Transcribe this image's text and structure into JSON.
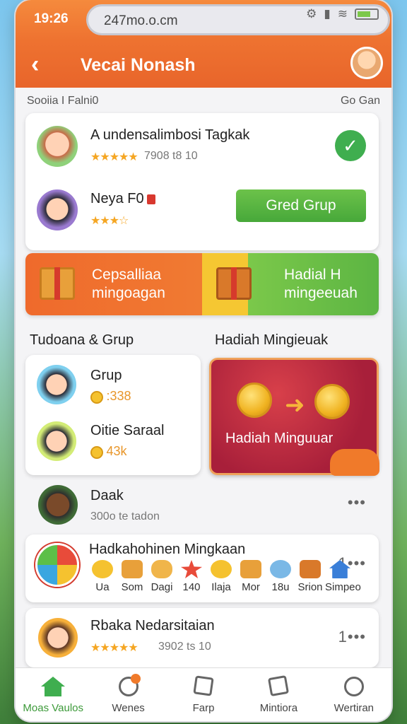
{
  "status": {
    "time": "19:26",
    "url": "247mo.o.cm"
  },
  "appbar": {
    "title": "Vecai Nonash"
  },
  "subhead": {
    "left": "Sooiia I Falni0",
    "right": "Go Gan"
  },
  "friends": [
    {
      "name": "A undensalimbosi Tagkak",
      "stars": "★★★★★",
      "meta": "7908 t8 10"
    },
    {
      "name": "Neya F0",
      "stars": "★★★☆",
      "button": "Gred Grup"
    }
  ],
  "banner": {
    "left": "Cepsalliaa\nmingoagan",
    "right": "Hadial H\nmingeeuah"
  },
  "sections": {
    "left": "Tudoana & Grup",
    "right": "Hadiah Mingieuak"
  },
  "groups": [
    {
      "name": "Grup",
      "value": ":338"
    },
    {
      "name": "Oitie Saraal",
      "value": "43k"
    }
  ],
  "reward_card": {
    "text": "Hadiah Minguuar"
  },
  "plain_row": {
    "name": "Daak",
    "meta": "300o te tadon"
  },
  "rewards_list": {
    "title": "Hadkahohinen Mingkaan",
    "count": "1",
    "items": [
      {
        "label": "Ua",
        "color": "#f5c22f"
      },
      {
        "label": "Som",
        "color": "#e8a03a"
      },
      {
        "label": "Dagi",
        "color": "#f0b54a"
      },
      {
        "label": "140",
        "color": "#e84b3a"
      },
      {
        "label": "Ilaja",
        "color": "#f5c22f"
      },
      {
        "label": "Mor",
        "color": "#e8a03a"
      },
      {
        "label": "18u",
        "color": "#7ab8e6"
      },
      {
        "label": "Srion",
        "color": "#d9792a"
      },
      {
        "label": "Simpeo",
        "color": "#3a7fd8"
      }
    ]
  },
  "last_row": {
    "name": "Rbaka Nedarsitaian",
    "stars": "★★★★★",
    "meta": "3902 ts 10",
    "count": "1"
  },
  "nav": [
    {
      "label": "Moas Vaulos",
      "icon": "home-icon",
      "active": true
    },
    {
      "label": "Wenes",
      "icon": "search-icon",
      "active": false
    },
    {
      "label": "Farp",
      "icon": "edit-icon",
      "active": false
    },
    {
      "label": "Mintiora",
      "icon": "mail-icon",
      "active": false
    },
    {
      "label": "Wertiran",
      "icon": "profile-icon",
      "active": false
    }
  ],
  "colors": {
    "primary": "#ee7230",
    "green": "#3fae4f",
    "gold": "#f5c22f",
    "reward_red": "#a81f3a"
  }
}
